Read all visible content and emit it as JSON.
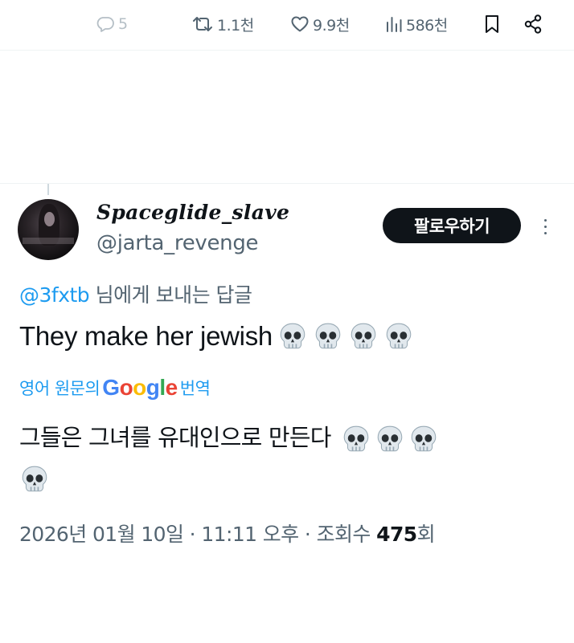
{
  "action_bar": {
    "reply_count": "5",
    "retweet_count": "1.1천",
    "like_count": "9.9천",
    "view_count": "586천"
  },
  "tweet": {
    "display_name": "Spaceglide_slave",
    "handle": "@jarta_revenge",
    "follow_label": "팔로우하기",
    "reply_mention": "@3fxtb",
    "reply_suffix": " 님에게 보내는 답글",
    "text": "They make her jewish",
    "translate_prefix": "영어 원문의",
    "translate_brand": "Google",
    "translate_suffix": "번역",
    "translated_text": "그들은 그녀를 유대인으로 만든다",
    "timestamp": "2026년 01월 10일 · 11:11 오후 · 조회수 ",
    "views": "475",
    "views_unit": "회"
  },
  "icons": {
    "reply": "reply-icon",
    "retweet": "retweet-icon",
    "like": "heart-icon",
    "views": "views-icon",
    "bookmark": "bookmark-icon",
    "share": "share-icon",
    "skull": "skull-emoji"
  },
  "colors": {
    "link": "#1d9bf0",
    "secondary_text": "#536471",
    "primary_text": "#0f1419",
    "follow_button_bg": "#0f1419"
  }
}
